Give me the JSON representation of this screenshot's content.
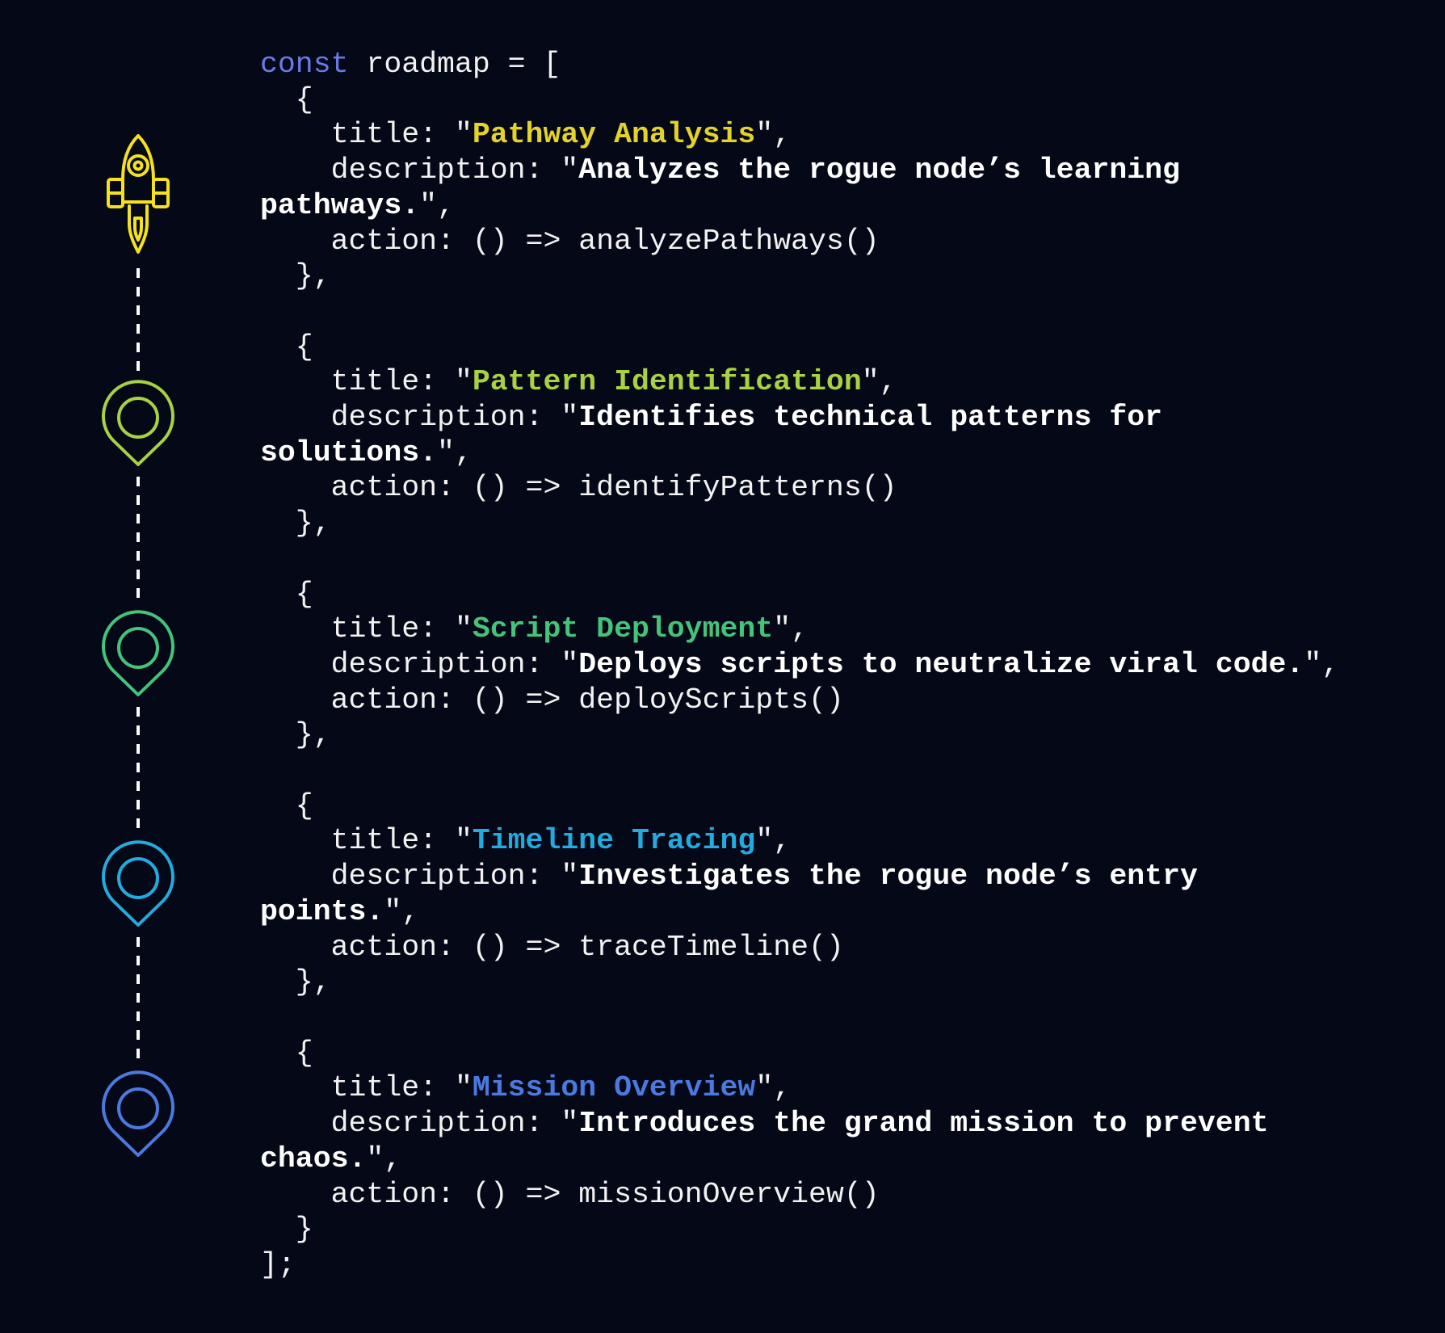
{
  "colors": {
    "background": "#050816",
    "text": "#f2f2f2",
    "keyword": "#6a7ae8",
    "rocket": "#f5e11c",
    "dash": "#ffffff"
  },
  "code": {
    "keyword": "const",
    "declaration": " roadmap = [",
    "closing": "];"
  },
  "roadmap_items": [
    {
      "title": "Pathway Analysis",
      "description_line1": "Analyzes the rogue node’s learning",
      "description_line2": "pathways.",
      "action": "analyzePathways()",
      "color": "#e3d22a",
      "icon": "rocket-icon"
    },
    {
      "title": "Pattern Identification",
      "description_line1": "Identifies technical patterns for",
      "description_line2": "solutions.",
      "action": "identifyPatterns()",
      "color": "#a8d143",
      "icon": "map-pin-icon"
    },
    {
      "title": "Script Deployment",
      "description_line1": "Deploys scripts to neutralize viral code.",
      "description_line2": "",
      "action": "deployScripts()",
      "color": "#44c47b",
      "icon": "map-pin-icon"
    },
    {
      "title": "Timeline Tracing",
      "description_line1": "Investigates the rogue node’s entry",
      "description_line2": "points.",
      "action": "traceTimeline()",
      "color": "#23aadf",
      "icon": "map-pin-icon"
    },
    {
      "title": "Mission Overview",
      "description_line1": "Introduces the grand mission to prevent",
      "description_line2": "chaos.",
      "action": "missionOverview()",
      "color": "#4a7ae0",
      "icon": "map-pin-icon"
    }
  ]
}
